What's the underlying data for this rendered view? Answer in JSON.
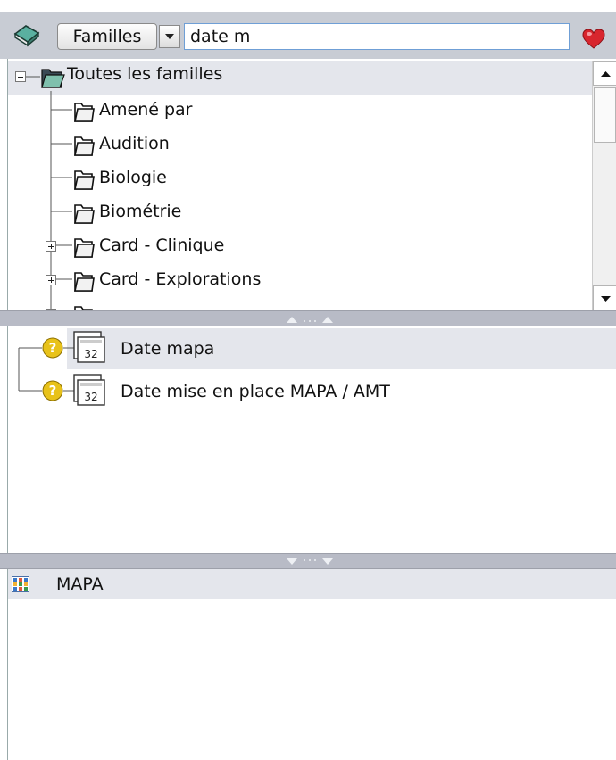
{
  "toolbar": {
    "category_button_label": "Familles",
    "search_value": "date m"
  },
  "tree": {
    "root_label": "Toutes les familles",
    "items": [
      {
        "label": "Amené par"
      },
      {
        "label": "Audition"
      },
      {
        "label": "Biologie"
      },
      {
        "label": "Biométrie"
      },
      {
        "label": "Card - Clinique"
      },
      {
        "label": "Card - Explorations"
      }
    ]
  },
  "results": {
    "items": [
      {
        "label": "Date mapa",
        "calendar_day": "32"
      },
      {
        "label": "Date mise en place MAPA / AMT",
        "calendar_day": "32"
      }
    ]
  },
  "bottom": {
    "title": "MAPA"
  },
  "colors": {
    "toolbar_bg": "#c8ccd4",
    "selected_row_bg": "#e4e6ec",
    "splitter_bg": "#b8bbc6",
    "search_border": "#6f9fd6",
    "heart": "#d8262e",
    "question_icon": "#e8c21a"
  }
}
